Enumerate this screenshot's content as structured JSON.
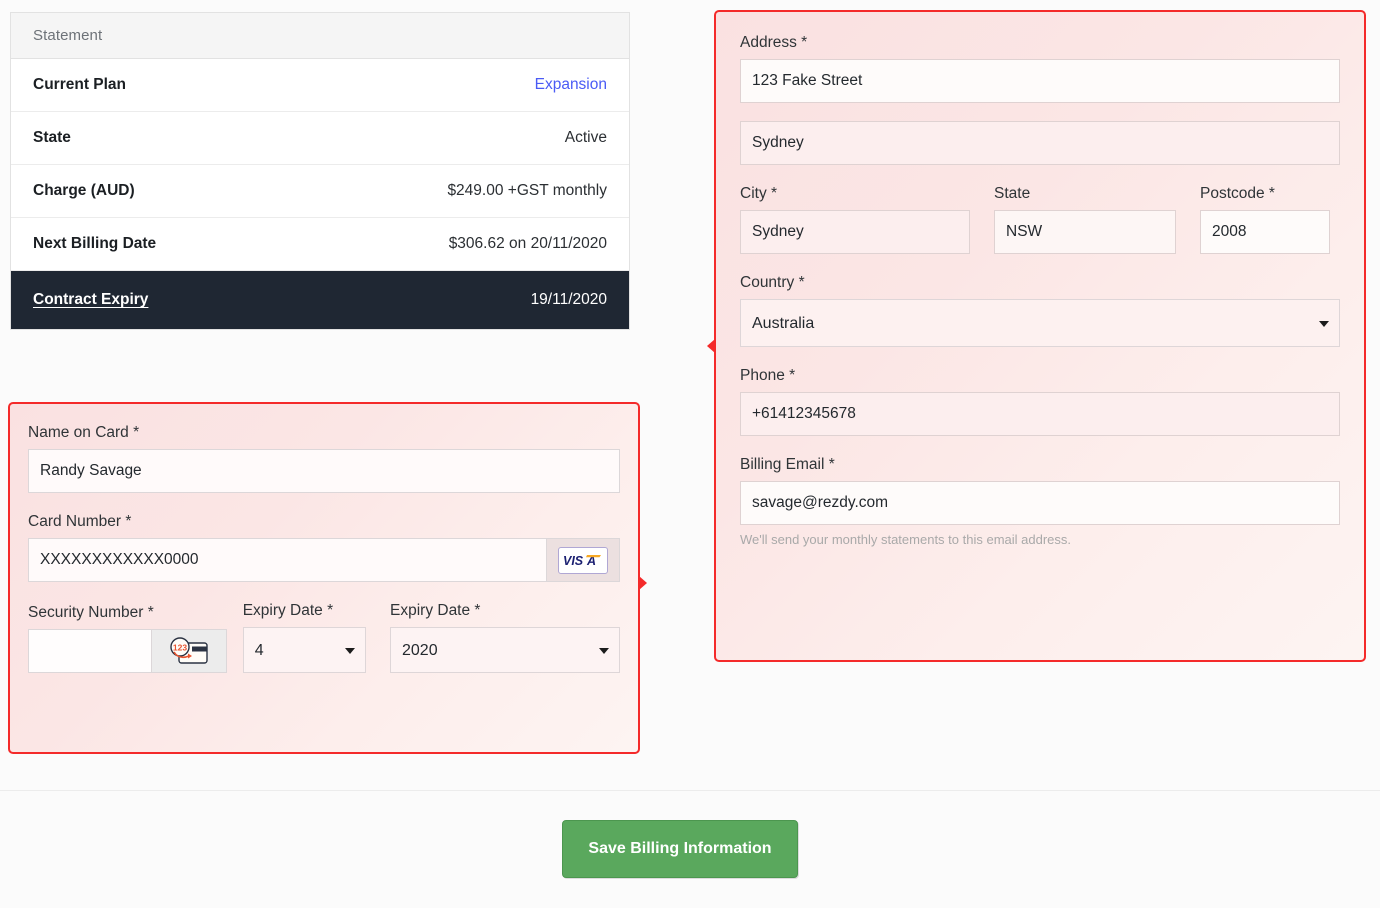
{
  "statement": {
    "header": "Statement",
    "rows": [
      {
        "label": "Current Plan",
        "value": "Expansion",
        "is_link": true
      },
      {
        "label": "State",
        "value": "Active",
        "is_link": false
      },
      {
        "label": "Charge (AUD)",
        "value": "$249.00 +GST monthly",
        "is_link": false
      },
      {
        "label": "Next Billing Date",
        "value": "$306.62 on 20/11/2020",
        "is_link": false
      },
      {
        "label": "Contract Expiry",
        "value": "19/11/2020",
        "is_link": false
      }
    ]
  },
  "card": {
    "name_label": "Name on Card *",
    "name_value": "Randy Savage",
    "number_label": "Card Number *",
    "number_value": "XXXXXXXXXXXX0000",
    "card_brand": "VISA",
    "security_label": "Security Number *",
    "security_value": "",
    "expiry_month_label": "Expiry Date *",
    "expiry_month_value": "4",
    "expiry_year_label": "Expiry Date *",
    "expiry_year_value": "2020"
  },
  "address": {
    "address_label": "Address *",
    "address_line1": "123 Fake Street",
    "address_line2": "Sydney",
    "city_label": "City *",
    "city_value": "Sydney",
    "state_label": "State",
    "state_value": "NSW",
    "postcode_label": "Postcode *",
    "postcode_value": "2008",
    "country_label": "Country *",
    "country_value": "Australia",
    "phone_label": "Phone *",
    "phone_value": "+61412345678",
    "email_label": "Billing Email *",
    "email_value": "savage@rezdy.com",
    "email_helper": "We'll send your monthly statements to this email address."
  },
  "footer": {
    "save_label": "Save Billing Information"
  },
  "colors": {
    "link": "#4a5bf5",
    "dark_row": "#1f2733",
    "validation_border": "#f42a2a",
    "save_button": "#5aa85d"
  }
}
